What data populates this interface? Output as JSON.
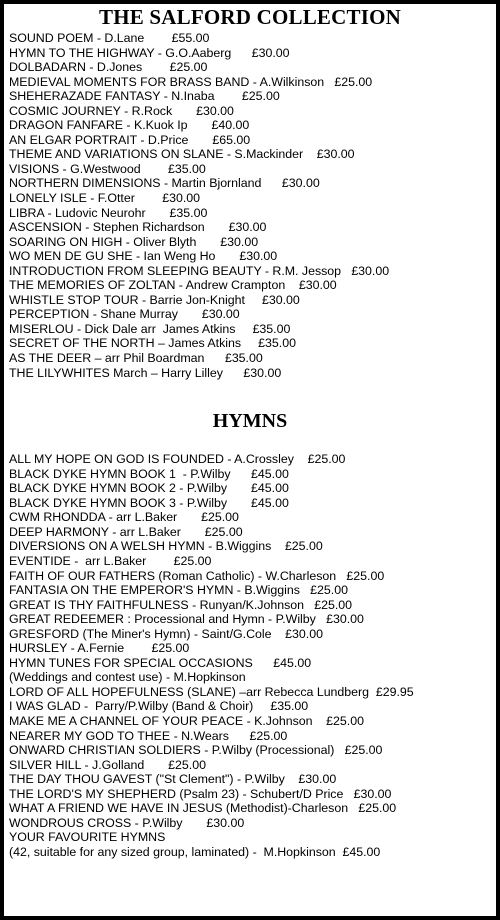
{
  "document": {
    "title": "THE SALFORD COLLECTION",
    "sections": [
      {
        "heading": "THE SALFORD COLLECTION",
        "entries": [
          "SOUND POEM - D.Lane        £55.00",
          "HYMN TO THE HIGHWAY - G.O.Aaberg      £30.00",
          "DOLBADARN - D.Jones        £25.00",
          "MEDIEVAL MOMENTS FOR BRASS BAND - A.Wilkinson   £25.00",
          "SHEHERAZADE FANTASY - N.Inaba        £25.00",
          "COSMIC JOURNEY - R.Rock       £30.00",
          "DRAGON FANFARE - K.Kuok Ip       £40.00",
          "AN ELGAR PORTRAIT - D.Price       £65.00",
          "THEME AND VARIATIONS ON SLANE - S.Mackinder    £30.00",
          "VISIONS - G.Westwood        £35.00",
          "NORTHERN DIMENSIONS - Martin Bjornland      £30.00",
          "LONELY ISLE - F.Otter        £30.00",
          "LIBRA - Ludovic Neurohr       £35.00",
          "ASCENSION - Stephen Richardson       £30.00",
          "SOARING ON HIGH - Oliver Blyth       £30.00",
          "WO MEN DE GU SHE - Ian Weng Ho       £30.00",
          "INTRODUCTION FROM SLEEPING BEAUTY - R.M. Jessop   £30.00",
          "THE MEMORIES OF ZOLTAN - Andrew Crampton    £30.00",
          "WHISTLE STOP TOUR - Barrie Jon-Knight     £30.00",
          "PERCEPTION - Shane Murray       £30.00",
          "MISERLOU - Dick Dale arr  James Atkins     £35.00",
          "SECRET OF THE NORTH – James Atkins     £35.00",
          "AS THE DEER – arr Phil Boardman      £35.00",
          "THE LILYWHITES March – Harry Lilley      £30.00"
        ]
      },
      {
        "heading": "HYMNS",
        "entries": [
          "ALL MY HOPE ON GOD IS FOUNDED - A.Crossley    £25.00",
          "BLACK DYKE HYMN BOOK 1  - P.Wilby      £45.00",
          "BLACK DYKE HYMN BOOK 2 - P.Wilby       £45.00",
          "BLACK DYKE HYMN BOOK 3 - P.Wilby       £45.00",
          "CWM RHONDDA - arr L.Baker       £25.00",
          "DEEP HARMONY - arr L.Baker       £25.00",
          "DIVERSIONS ON A WELSH HYMN - B.Wiggins    £25.00",
          "EVENTIDE -  arr L.Baker        £25.00",
          "FAITH OF OUR FATHERS (Roman Catholic) - W.Charleson   £25.00",
          "FANTASIA ON THE EMPEROR'S HYMN - B.Wiggins   £25.00",
          "GREAT IS THY FAITHFULNESS - Runyan/K.Johnson   £25.00",
          "GREAT REDEEMER : Processional and Hymn - P.Wilby   £30.00",
          "GRESFORD (The Miner's Hymn) - Saint/G.Cole    £30.00",
          "HURSLEY - A.Fernie        £25.00",
          "HYMN TUNES FOR SPECIAL OCCASIONS      £45.00",
          "(Weddings and contest use) - M.Hopkinson",
          "LORD OF ALL HOPEFULNESS (SLANE) –arr Rebecca Lundberg  £29.95",
          "I WAS GLAD -  Parry/P.Wilby (Band & Choir)     £35.00",
          "MAKE ME A CHANNEL OF YOUR PEACE - K.Johnson    £25.00",
          "NEARER MY GOD TO THEE - N.Wears      £25.00",
          "ONWARD CHRISTIAN SOLDIERS - P.Wilby (Processional)   £25.00",
          "SILVER HILL - J.Golland       £25.00",
          "THE DAY THOU GAVEST (\"St Clement\") - P.Wilby    £30.00",
          "THE LORD'S MY SHEPHERD (Psalm 23) - Schubert/D Price   £30.00",
          "WHAT A FRIEND WE HAVE IN JESUS (Methodist)-Charleson   £25.00",
          "WONDROUS CROSS - P.Wilby       £30.00",
          "YOUR FAVOURITE HYMNS",
          "(42, suitable for any sized group, laminated) -  M.Hopkinson  £45.00"
        ]
      }
    ]
  }
}
